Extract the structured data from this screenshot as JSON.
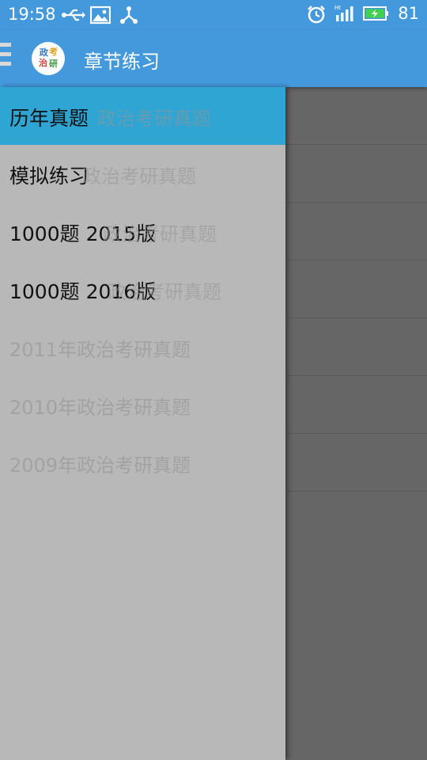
{
  "status_bar": {
    "time": "19:58",
    "battery_level": "81",
    "icons": [
      "usb-icon",
      "image-icon",
      "share-icon",
      "alarm-icon",
      "signal-icon",
      "battery-icon"
    ]
  },
  "app_bar": {
    "title": "章节练习",
    "logo_chars": [
      "政",
      "考",
      "治",
      "研"
    ],
    "color": "#4499DD"
  },
  "drawer": {
    "items": [
      {
        "label": "历年真题",
        "active": true
      },
      {
        "label": "模拟练习"
      },
      {
        "label": "1000题 2015版"
      },
      {
        "label": "1000题 2016版"
      }
    ],
    "active_color": "#2EA5D2"
  },
  "background_list": {
    "items": [
      "政治考研真题",
      "政治考研真题",
      "政治考研真题",
      "政治考研真题",
      "2011年政治考研真题",
      "2010年政治考研真题",
      "2009年政治考研真题"
    ]
  }
}
